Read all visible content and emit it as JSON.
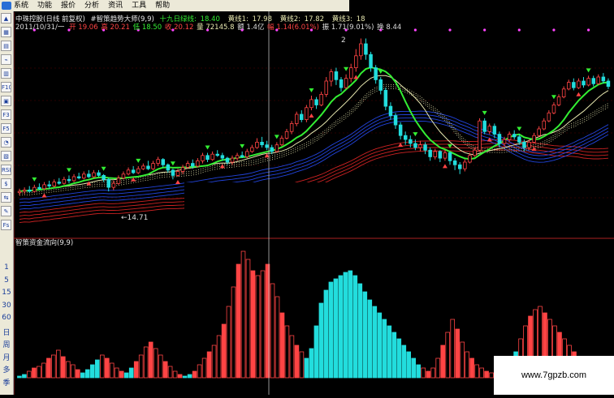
{
  "menu": {
    "items": [
      "系统",
      "功能",
      "报价",
      "分析",
      "资讯",
      "工具",
      "帮助"
    ]
  },
  "toolbar": {
    "buttons": [
      {
        "label": "▲",
        "icon": "arrow-up-icon"
      },
      {
        "label": "▦",
        "icon": "grid-icon"
      },
      {
        "label": "▤",
        "icon": "list-icon"
      },
      {
        "label": "⌁",
        "icon": "line-chart-icon"
      },
      {
        "label": "▥",
        "icon": "bar-chart-icon"
      },
      {
        "label": "F10",
        "icon": "f10-icon"
      },
      {
        "label": "▣",
        "icon": "window-icon"
      },
      {
        "label": "F3",
        "icon": "f3-icon"
      },
      {
        "label": "F5",
        "icon": "f5-icon"
      },
      {
        "label": "◔",
        "icon": "pie-icon"
      },
      {
        "label": "▧",
        "icon": "chart-icon"
      },
      {
        "label": "RSI",
        "icon": "rsi-icon"
      },
      {
        "label": "$",
        "icon": "money-icon"
      },
      {
        "label": "⇆",
        "icon": "swap-icon"
      },
      {
        "label": "✎",
        "icon": "pencil-icon"
      },
      {
        "label": "Fs",
        "icon": "fs-icon"
      }
    ],
    "periods": [
      "1",
      "5",
      "15",
      "30",
      "60",
      "日",
      "周",
      "月",
      "多",
      "季"
    ]
  },
  "header": {
    "row1": {
      "name": "中珠控股(日线 前复权)",
      "indicator": "#智策趋势大师(9,9)",
      "line1_label": "十九日绿线:",
      "line1_value": "18.40",
      "line2_label": "黄线1:",
      "line2_value": "17.98",
      "line3_label": "黄线2:",
      "line3_value": "17.82",
      "line4_label": "黄线3:",
      "line4_value": "18"
    },
    "row2": {
      "date": "2011/10/31/一",
      "open_label": "开",
      "open": "19.06",
      "high_label": "高",
      "high": "20.21",
      "low_label": "低",
      "low": "18.50",
      "close_label": "收",
      "close": "20.12",
      "vol_label": "量",
      "vol": "72145.8",
      "amt_label": "额",
      "amt": "1.4亿",
      "chg_label": "幅",
      "chg": "1.14(6.01%)",
      "amp_label": "振",
      "amp": "1.71(9.01%)",
      "turn_label": "换",
      "turn": "8.44"
    }
  },
  "annotations": {
    "low_price": "←14.71",
    "high_price": "2"
  },
  "lower_panel": {
    "title": "智策资金流向(9,9)"
  },
  "colors": {
    "up": "#ff4444",
    "down": "#22dddd",
    "green_line": "#33ee33",
    "yellow_line": "#e8e8b0",
    "blue_line": "#2244dd",
    "red_line": "#cc2222",
    "marker": "#ff44ff"
  },
  "watermark": "www.7gpzb.com",
  "chart_data": [
    {
      "type": "candlestick",
      "title": "中珠控股(日线 前复权)",
      "series": [
        {
          "name": "十九日绿线",
          "last": 18.4
        },
        {
          "name": "黄线1",
          "last": 17.98
        },
        {
          "name": "黄线2",
          "last": 17.82
        }
      ],
      "candles": [
        [
          16.2,
          16.3,
          16.5,
          16.0
        ],
        [
          16.3,
          16.4,
          16.6,
          16.1
        ],
        [
          16.4,
          16.3,
          16.7,
          16.2
        ],
        [
          16.3,
          16.6,
          16.8,
          16.2
        ],
        [
          16.6,
          16.5,
          16.9,
          16.4
        ],
        [
          16.5,
          16.8,
          17.0,
          16.4
        ],
        [
          16.8,
          16.7,
          17.1,
          16.5
        ],
        [
          16.7,
          17.0,
          17.2,
          16.6
        ],
        [
          17.0,
          16.9,
          17.3,
          16.8
        ],
        [
          16.9,
          17.2,
          17.4,
          16.8
        ],
        [
          17.2,
          17.1,
          17.5,
          16.9
        ],
        [
          17.1,
          17.4,
          17.6,
          17.0
        ],
        [
          17.4,
          17.3,
          17.7,
          17.2
        ],
        [
          17.3,
          17.6,
          17.8,
          17.2
        ],
        [
          17.6,
          17.4,
          17.9,
          17.3
        ],
        [
          17.4,
          17.7,
          17.9,
          17.3
        ],
        [
          17.7,
          17.5,
          17.9,
          17.4
        ],
        [
          17.5,
          17.2,
          17.6,
          17.0
        ],
        [
          17.2,
          16.6,
          17.3,
          16.3
        ],
        [
          16.6,
          16.9,
          17.1,
          16.4
        ],
        [
          16.9,
          17.3,
          17.5,
          16.8
        ],
        [
          17.3,
          17.6,
          17.8,
          17.2
        ],
        [
          17.6,
          17.9,
          18.1,
          17.5
        ],
        [
          17.9,
          17.7,
          18.2,
          17.6
        ],
        [
          17.7,
          18.0,
          18.2,
          17.6
        ],
        [
          18.0,
          18.2,
          18.4,
          17.9
        ],
        [
          18.2,
          18.0,
          18.6,
          17.9
        ],
        [
          18.0,
          18.4,
          18.6,
          17.9
        ],
        [
          18.4,
          18.7,
          18.9,
          18.2
        ],
        [
          18.7,
          18.3,
          18.8,
          18.1
        ],
        [
          18.3,
          17.9,
          18.4,
          17.7
        ],
        [
          17.9,
          17.5,
          18.0,
          17.2
        ],
        [
          17.5,
          17.8,
          18.0,
          17.4
        ],
        [
          17.8,
          18.1,
          18.3,
          17.6
        ],
        [
          18.1,
          18.4,
          18.6,
          18.0
        ],
        [
          18.4,
          18.2,
          18.7,
          18.0
        ],
        [
          18.2,
          18.6,
          18.8,
          18.1
        ],
        [
          18.6,
          19.0,
          19.2,
          18.4
        ],
        [
          19.0,
          18.7,
          19.2,
          18.5
        ],
        [
          18.7,
          19.1,
          19.3,
          18.6
        ],
        [
          19.1,
          19.0,
          19.4,
          18.9
        ],
        [
          19.0,
          18.8,
          19.2,
          18.6
        ],
        [
          18.8,
          18.5,
          18.9,
          18.3
        ],
        [
          18.5,
          18.8,
          19.0,
          18.3
        ],
        [
          18.8,
          19.0,
          19.2,
          18.6
        ],
        [
          19.0,
          18.9,
          19.3,
          18.8
        ],
        [
          18.9,
          19.3,
          19.5,
          18.8
        ],
        [
          19.3,
          19.6,
          19.8,
          19.2
        ],
        [
          19.6,
          20.0,
          20.3,
          19.5
        ],
        [
          20.0,
          19.8,
          20.4,
          19.6
        ],
        [
          19.8,
          19.6,
          20.1,
          19.4
        ],
        [
          19.6,
          19.3,
          19.8,
          19.1
        ],
        [
          19.3,
          19.8,
          20.0,
          19.2
        ],
        [
          19.8,
          20.3,
          20.5,
          19.7
        ],
        [
          20.3,
          20.8,
          21.0,
          20.2
        ],
        [
          20.8,
          21.4,
          21.6,
          20.6
        ],
        [
          21.4,
          22.1,
          22.3,
          21.2
        ],
        [
          22.1,
          21.7,
          22.4,
          21.5
        ],
        [
          21.7,
          22.6,
          22.8,
          21.5
        ],
        [
          22.6,
          23.2,
          23.5,
          22.4
        ],
        [
          23.2,
          22.8,
          23.4,
          22.5
        ],
        [
          22.8,
          23.6,
          23.8,
          22.7
        ],
        [
          23.6,
          24.6,
          24.9,
          23.4
        ],
        [
          24.6,
          25.3,
          25.5,
          24.2
        ],
        [
          25.3,
          24.7,
          25.6,
          24.3
        ],
        [
          24.7,
          24.1,
          24.9,
          23.8
        ],
        [
          24.1,
          24.8,
          25.1,
          24.0
        ],
        [
          24.8,
          25.6,
          25.9,
          24.5
        ],
        [
          25.6,
          26.5,
          27.0,
          25.3
        ],
        [
          26.5,
          27.4,
          27.8,
          26.2
        ],
        [
          27.4,
          26.6,
          27.8,
          26.2
        ],
        [
          26.6,
          25.6,
          26.8,
          25.3
        ],
        [
          25.6,
          24.7,
          25.8,
          24.4
        ],
        [
          24.7,
          23.9,
          24.9,
          23.6
        ],
        [
          23.9,
          22.7,
          24.1,
          22.4
        ],
        [
          22.7,
          22.0,
          23.0,
          21.7
        ],
        [
          22.0,
          21.3,
          22.2,
          21.0
        ],
        [
          21.3,
          20.5,
          21.5,
          20.2
        ],
        [
          20.5,
          20.2,
          20.8,
          19.8
        ],
        [
          20.2,
          19.9,
          20.5,
          19.6
        ],
        [
          19.9,
          19.6,
          20.2,
          19.4
        ],
        [
          19.6,
          19.8,
          20.1,
          19.3
        ],
        [
          19.8,
          19.4,
          20.0,
          19.1
        ],
        [
          19.4,
          18.9,
          19.6,
          18.6
        ],
        [
          18.9,
          19.3,
          19.5,
          18.7
        ],
        [
          19.3,
          18.8,
          19.4,
          18.5
        ],
        [
          18.8,
          19.2,
          19.4,
          18.6
        ],
        [
          19.2,
          18.6,
          19.3,
          18.3
        ],
        [
          18.6,
          18.3,
          18.8,
          17.9
        ],
        [
          18.3,
          18.0,
          18.5,
          17.6
        ],
        [
          18.0,
          18.5,
          18.7,
          17.8
        ],
        [
          18.5,
          19.0,
          19.2,
          18.4
        ],
        [
          19.0,
          19.4,
          19.6,
          18.9
        ],
        [
          19.4,
          21.6,
          21.8,
          19.3
        ],
        [
          21.6,
          20.8,
          21.8,
          20.6
        ],
        [
          20.8,
          21.2,
          21.4,
          20.6
        ],
        [
          21.2,
          20.6,
          21.4,
          20.3
        ],
        [
          20.6,
          19.9,
          20.8,
          19.6
        ],
        [
          19.9,
          20.2,
          20.4,
          19.7
        ],
        [
          20.2,
          20.6,
          20.8,
          20.0
        ],
        [
          20.6,
          20.4,
          20.9,
          20.2
        ],
        [
          20.4,
          20.0,
          20.6,
          19.8
        ],
        [
          20.0,
          19.6,
          20.2,
          19.3
        ],
        [
          19.6,
          20.0,
          20.2,
          19.4
        ],
        [
          20.0,
          20.5,
          20.7,
          19.9
        ],
        [
          20.5,
          21.0,
          21.2,
          20.4
        ],
        [
          21.0,
          21.6,
          21.8,
          20.9
        ],
        [
          21.6,
          22.2,
          22.4,
          21.5
        ],
        [
          22.2,
          22.8,
          23.0,
          22.1
        ],
        [
          22.8,
          23.4,
          23.6,
          22.7
        ],
        [
          23.4,
          24.0,
          24.2,
          23.3
        ],
        [
          24.0,
          24.5,
          24.7,
          23.9
        ],
        [
          24.5,
          24.1,
          24.8,
          23.9
        ],
        [
          24.1,
          24.6,
          24.8,
          24.0
        ],
        [
          24.6,
          24.3,
          24.9,
          24.1
        ],
        [
          24.3,
          24.8,
          25.0,
          24.2
        ],
        [
          24.8,
          24.4,
          25.0,
          24.2
        ],
        [
          24.4,
          24.9,
          25.1,
          24.3
        ],
        [
          24.9,
          24.6,
          25.2,
          24.4
        ],
        [
          24.6,
          24.2,
          24.8,
          24.0
        ]
      ],
      "annotations": [
        "←14.71"
      ]
    },
    {
      "type": "bar",
      "title": "智策资金流向(9,9)",
      "ylabel": "",
      "values": [
        1,
        2,
        4,
        6,
        7,
        9,
        12,
        14,
        17,
        13,
        10,
        8,
        5,
        3,
        5,
        8,
        11,
        14,
        12,
        9,
        6,
        4,
        3,
        6,
        10,
        14,
        19,
        22,
        18,
        14,
        10,
        7,
        4,
        2,
        1,
        2,
        4,
        8,
        12,
        16,
        20,
        26,
        33,
        44,
        56,
        70,
        78,
        73,
        66,
        63,
        66,
        70,
        58,
        50,
        40,
        32,
        26,
        20,
        16,
        12,
        18,
        32,
        46,
        54,
        59,
        61,
        63,
        65,
        66,
        63,
        58,
        53,
        48,
        44,
        40,
        36,
        32,
        28,
        24,
        20,
        16,
        12,
        8,
        6,
        4,
        6,
        12,
        20,
        28,
        36,
        30,
        22,
        16,
        12,
        8,
        6,
        4,
        3,
        2,
        4,
        6,
        10,
        16,
        24,
        32,
        38,
        42,
        44,
        40,
        36,
        32,
        28,
        24,
        20,
        16,
        12,
        8,
        6,
        4,
        3,
        2,
        1
      ],
      "colors": [
        "c",
        "c",
        "r",
        "r",
        "r",
        "r",
        "r",
        "r",
        "r",
        "r",
        "r",
        "r",
        "r",
        "c",
        "c",
        "c",
        "c",
        "r",
        "r",
        "r",
        "r",
        "r",
        "c",
        "c",
        "r",
        "r",
        "r",
        "r",
        "r",
        "r",
        "r",
        "r",
        "r",
        "r",
        "c",
        "c",
        "r",
        "r",
        "r",
        "r",
        "r",
        "r",
        "r",
        "r",
        "r",
        "r",
        "r",
        "r",
        "r",
        "r",
        "r",
        "r",
        "r",
        "r",
        "r",
        "r",
        "r",
        "r",
        "r",
        "c",
        "c",
        "c",
        "c",
        "c",
        "c",
        "c",
        "c",
        "c",
        "c",
        "c",
        "c",
        "c",
        "c",
        "c",
        "c",
        "c",
        "c",
        "c",
        "c",
        "c",
        "c",
        "c",
        "c",
        "r",
        "r",
        "r",
        "r",
        "r",
        "r",
        "r",
        "r",
        "r",
        "r",
        "r",
        "r",
        "r",
        "r",
        "r",
        "r",
        "c",
        "c",
        "c",
        "c",
        "r",
        "r",
        "r",
        "r",
        "r",
        "r",
        "r",
        "r",
        "r",
        "r",
        "r",
        "r",
        "r",
        "r",
        "r",
        "r",
        "r",
        "r",
        "r"
      ]
    }
  ]
}
